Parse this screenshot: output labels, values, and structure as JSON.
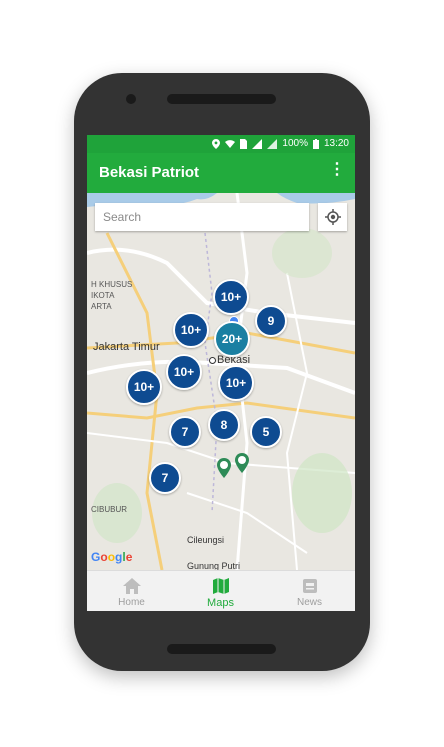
{
  "status_bar": {
    "battery": "100%",
    "time": "13:20"
  },
  "app_bar": {
    "title": "Bekasi Patriot",
    "menu_icon": "more-vert-icon"
  },
  "search": {
    "placeholder": "Search"
  },
  "map": {
    "labels": {
      "jakarta_timur": "Jakarta Timur",
      "bekasi": "Bekasi",
      "cileungsi": "Cileungsi",
      "gunung_putri": "Gunung Putri",
      "khusus": "H KHUSUS",
      "ikota": "IKOTA",
      "karta": "ARTA",
      "cibubur": "CIBUBUR",
      "google": "Google"
    },
    "clusters": [
      {
        "label": "10+",
        "color": "#0e4b91"
      },
      {
        "label": "10+",
        "color": "#0e4b91"
      },
      {
        "label": "9",
        "color": "#0e4b91"
      },
      {
        "label": "20+",
        "color": "#1a7fa2"
      },
      {
        "label": "10+",
        "color": "#0e4b91"
      },
      {
        "label": "10+",
        "color": "#0e4b91"
      },
      {
        "label": "10+",
        "color": "#0e4b91"
      },
      {
        "label": "7",
        "color": "#0e4b91"
      },
      {
        "label": "8",
        "color": "#0e4b91"
      },
      {
        "label": "5",
        "color": "#0e4b91"
      },
      {
        "label": "7",
        "color": "#0e4b91"
      }
    ]
  },
  "bottom_nav": [
    {
      "label": "Home",
      "icon": "home-icon",
      "active": false
    },
    {
      "label": "Maps",
      "icon": "map-icon",
      "active": true
    },
    {
      "label": "News",
      "icon": "news-icon",
      "active": false
    }
  ],
  "colors": {
    "primary": "#22ab3d",
    "cluster": "#0e4b91",
    "cluster_alt": "#1a7fa2"
  }
}
